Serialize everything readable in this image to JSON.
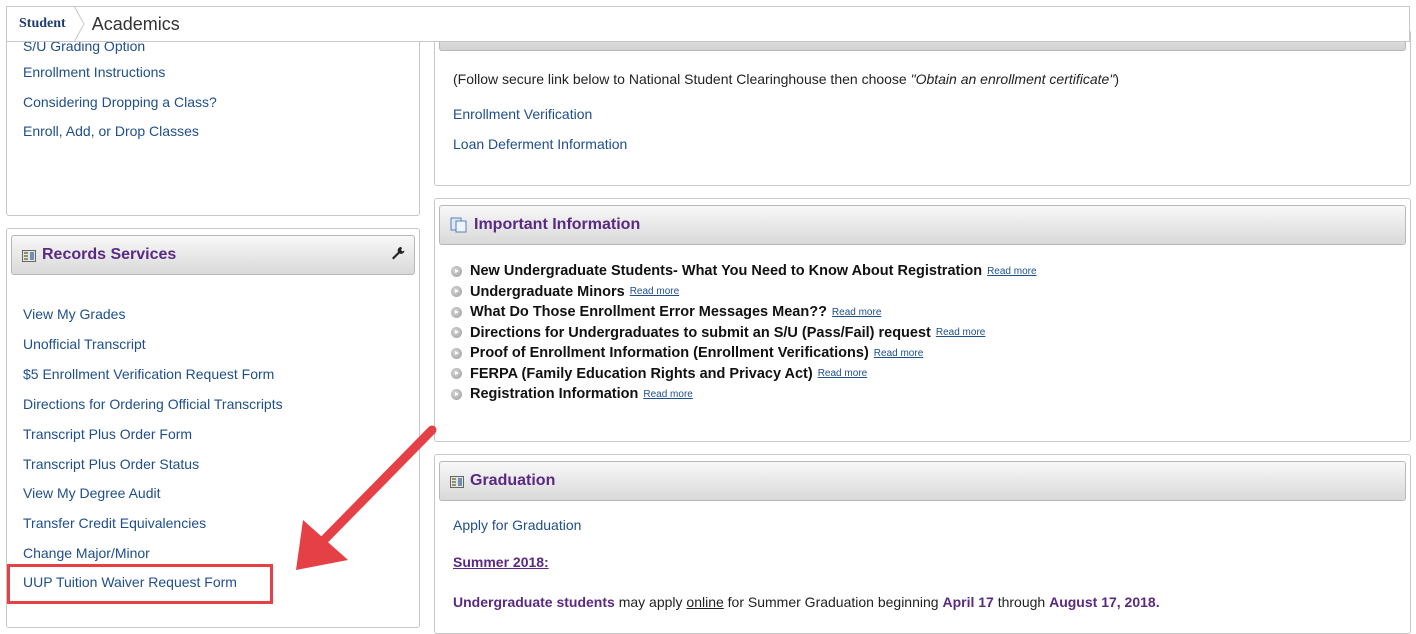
{
  "breadcrumb": {
    "root": "Student",
    "current": "Academics"
  },
  "enrollment_panel": {
    "partial_item": "S/U Grading Option",
    "items": [
      "Enrollment Instructions",
      "Considering Dropping a Class?",
      "Enroll, Add, or Drop Classes"
    ]
  },
  "records_services": {
    "title": "Records Services",
    "items": [
      "View My Grades",
      "Unofficial Transcript",
      "$5 Enrollment Verification Request Form",
      "Directions for Ordering Official Transcripts",
      "Transcript Plus Order Form",
      "Transcript Plus Order Status",
      "View My Degree Audit",
      "Transfer Credit Equivalencies",
      "Change Major/Minor",
      "UUP Tuition Waiver Request Form"
    ]
  },
  "enrollment_verification": {
    "note_prefix": "(Follow secure link below to National Student Clearinghouse then choose ",
    "note_italic": "\"Obtain an enrollment certificate\"",
    "note_suffix": ")",
    "links": [
      "Enrollment Verification",
      "Loan Deferment Information"
    ]
  },
  "important_information": {
    "title": "Important Information",
    "read_more": "Read more",
    "items": [
      "New Undergraduate Students- What You Need to Know About Registration",
      "Undergraduate Minors",
      "What Do Those Enrollment Error Messages Mean??",
      "Directions for Undergraduates to submit an S/U (Pass/Fail) request",
      "Proof of Enrollment Information (Enrollment Verifications)",
      "FERPA (Family Education Rights and Privacy Act)",
      "Registration Information"
    ]
  },
  "graduation": {
    "title": "Graduation",
    "apply_link": "Apply for Graduation",
    "term_heading": "Summer 2018:",
    "line_part1": "Undergraduate students",
    "line_part2": " may apply ",
    "line_online": "online",
    "line_part3": " for Summer Graduation beginning ",
    "line_date1": "April 17",
    "line_part4": " through ",
    "line_date2": "August 17, 2018."
  },
  "colors": {
    "accent_purple": "#5a2a82",
    "link_blue": "#1f4e8c",
    "highlight_red": "#e54046"
  },
  "icons": [
    "panel-icon",
    "wrench-icon",
    "documents-icon",
    "bullet-arrow-icon"
  ]
}
